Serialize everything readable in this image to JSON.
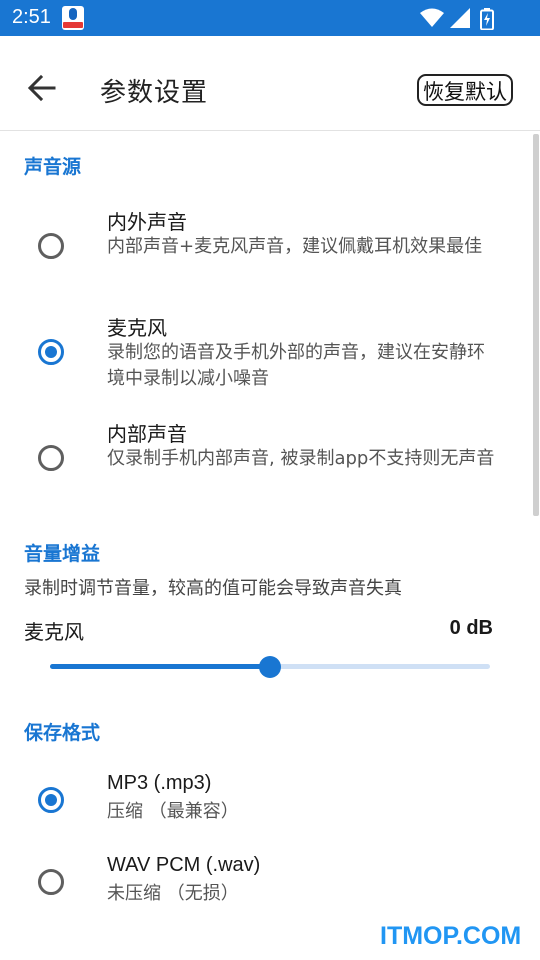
{
  "status_bar": {
    "time": "2:51",
    "app_icon": "recorder-app-icon",
    "icons": [
      "wifi-icon",
      "cell-signal-icon",
      "battery-charging-icon"
    ],
    "color": "#1976d2"
  },
  "toolbar": {
    "back_icon": "arrow-back-icon",
    "title": "参数设置",
    "reset_label": "恢复默认"
  },
  "sound_source": {
    "title": "声音源",
    "options": [
      {
        "title": "内外声音",
        "desc": "内部声音+麦克风声音，建议佩戴耳机效果最佳",
        "selected": false
      },
      {
        "title": "麦克风",
        "desc": "录制您的语音及手机外部的声音，建议在安静环境中录制以减小噪音",
        "selected": true
      },
      {
        "title": "内部声音",
        "desc": "仅录制手机内部声音, 被录制app不支持则无声音",
        "selected": false
      }
    ]
  },
  "volume_gain": {
    "title": "音量增益",
    "desc": "录制时调节音量，较高的值可能会导致声音失真",
    "mic_label": "麦克风",
    "value_label": "0 dB",
    "slider_fraction": 0.5
  },
  "save_format": {
    "title": "保存格式",
    "options": [
      {
        "title": "MP3 (.mp3)",
        "desc": "压缩 （最兼容）",
        "selected": true
      },
      {
        "title": "WAV PCM (.wav)",
        "desc": "未压缩 （无损）",
        "selected": false
      }
    ]
  },
  "watermark": "ITMOP.COM",
  "accent_color": "#1976d2"
}
